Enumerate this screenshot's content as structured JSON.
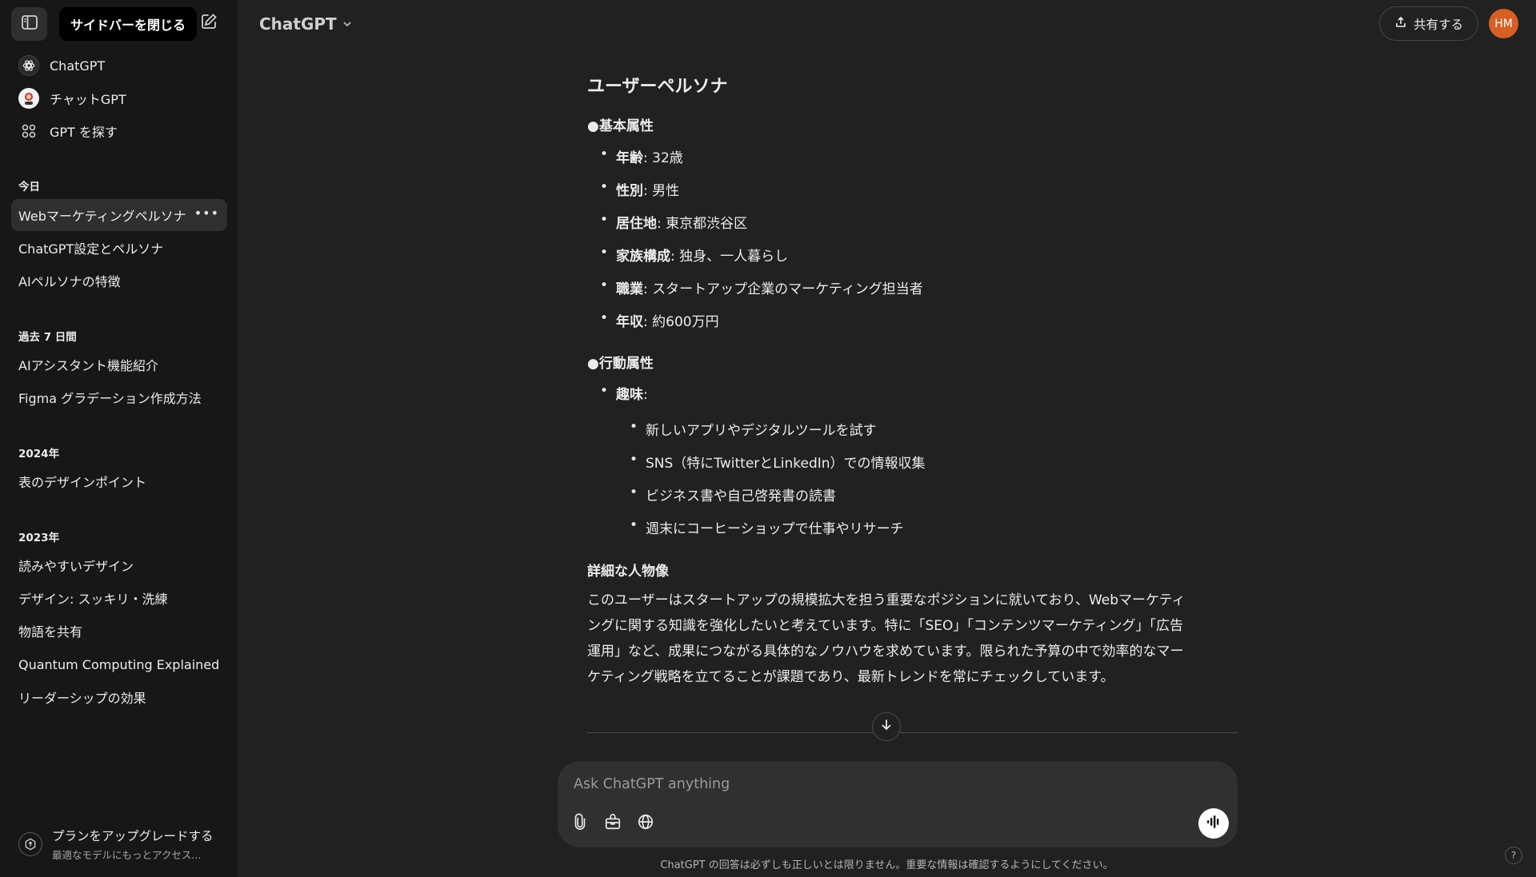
{
  "sidebar": {
    "tooltip": "サイドバーを閉じる",
    "links": [
      {
        "label": "ChatGPT",
        "icon": "openai-icon"
      },
      {
        "label": "チャットGPT",
        "icon": "custom-gpt-avatar"
      },
      {
        "label": "GPT を探す",
        "icon": "grid-icon"
      }
    ],
    "sections": [
      {
        "title": "今日",
        "items": [
          "Webマーケティングペルソナ",
          "ChatGPT設定とペルソナ",
          "AIペルソナの特徴"
        ]
      },
      {
        "title": "過去 7 日間",
        "items": [
          "AIアシスタント機能紹介",
          "Figma グラデーション作成方法"
        ]
      },
      {
        "title": "2024年",
        "items": [
          "表のデザインポイント"
        ]
      },
      {
        "title": "2023年",
        "items": [
          "読みやすいデザイン",
          "デザイン: スッキリ・洗練",
          "物語を共有",
          "Quantum Computing Explained",
          "リーダーシップの効果"
        ]
      }
    ],
    "more_label": "•••",
    "upgrade": {
      "title": "プランをアップグレードする",
      "subtitle": "最適なモデルにもっとアクセス..."
    }
  },
  "header": {
    "model": "ChatGPT",
    "share": "共有する",
    "avatar": "HM"
  },
  "content": {
    "title": "ユーザーペルソナ",
    "basic_heading": "●基本属性",
    "basic": [
      {
        "key": "年齢",
        "value": ": 32歳"
      },
      {
        "key": "性別",
        "value": ": 男性"
      },
      {
        "key": "居住地",
        "value": ": 東京都渋谷区"
      },
      {
        "key": "家族構成",
        "value": ": 独身、一人暮らし"
      },
      {
        "key": "職業",
        "value": ": スタートアップ企業のマーケティング担当者"
      },
      {
        "key": "年収",
        "value": ": 約600万円"
      }
    ],
    "behavior_heading": "●行動属性",
    "hobby_key": "趣味",
    "hobby_colon": ":",
    "hobbies": [
      "新しいアプリやデジタルツールを試す",
      "SNS（特にTwitterとLinkedIn）での情報収集",
      "ビジネス書や自己啓発書の読書",
      "週末にコーヒーショップで仕事やリサーチ"
    ],
    "detail_heading": "詳細な人物像",
    "detail_lines": [
      "このユーザーはスタートアップの規模拡大を担う重要なポジションに就いており、Webマーケティ",
      "ングに関する知識を強化したいと考えています。特に「SEO」「コンテンツマーケティング」「広告",
      "運用」など、成果につながる具体的なノウハウを求めています。限られた予算の中で効率的なマー",
      "ケティング戦略を立てることが課題であり、最新トレンドを常にチェックしています。"
    ]
  },
  "composer": {
    "placeholder": "Ask ChatGPT anything"
  },
  "footer": {
    "disclaimer": "ChatGPT の回答は必ずしも正しいとは限りません。重要な情報は確認するようにしてください。",
    "help": "?"
  },
  "colors": {
    "sidebar_bg": "#171717",
    "main_bg": "#212121",
    "avatar_bg": "#d55f24",
    "composer_bg": "#303030"
  }
}
